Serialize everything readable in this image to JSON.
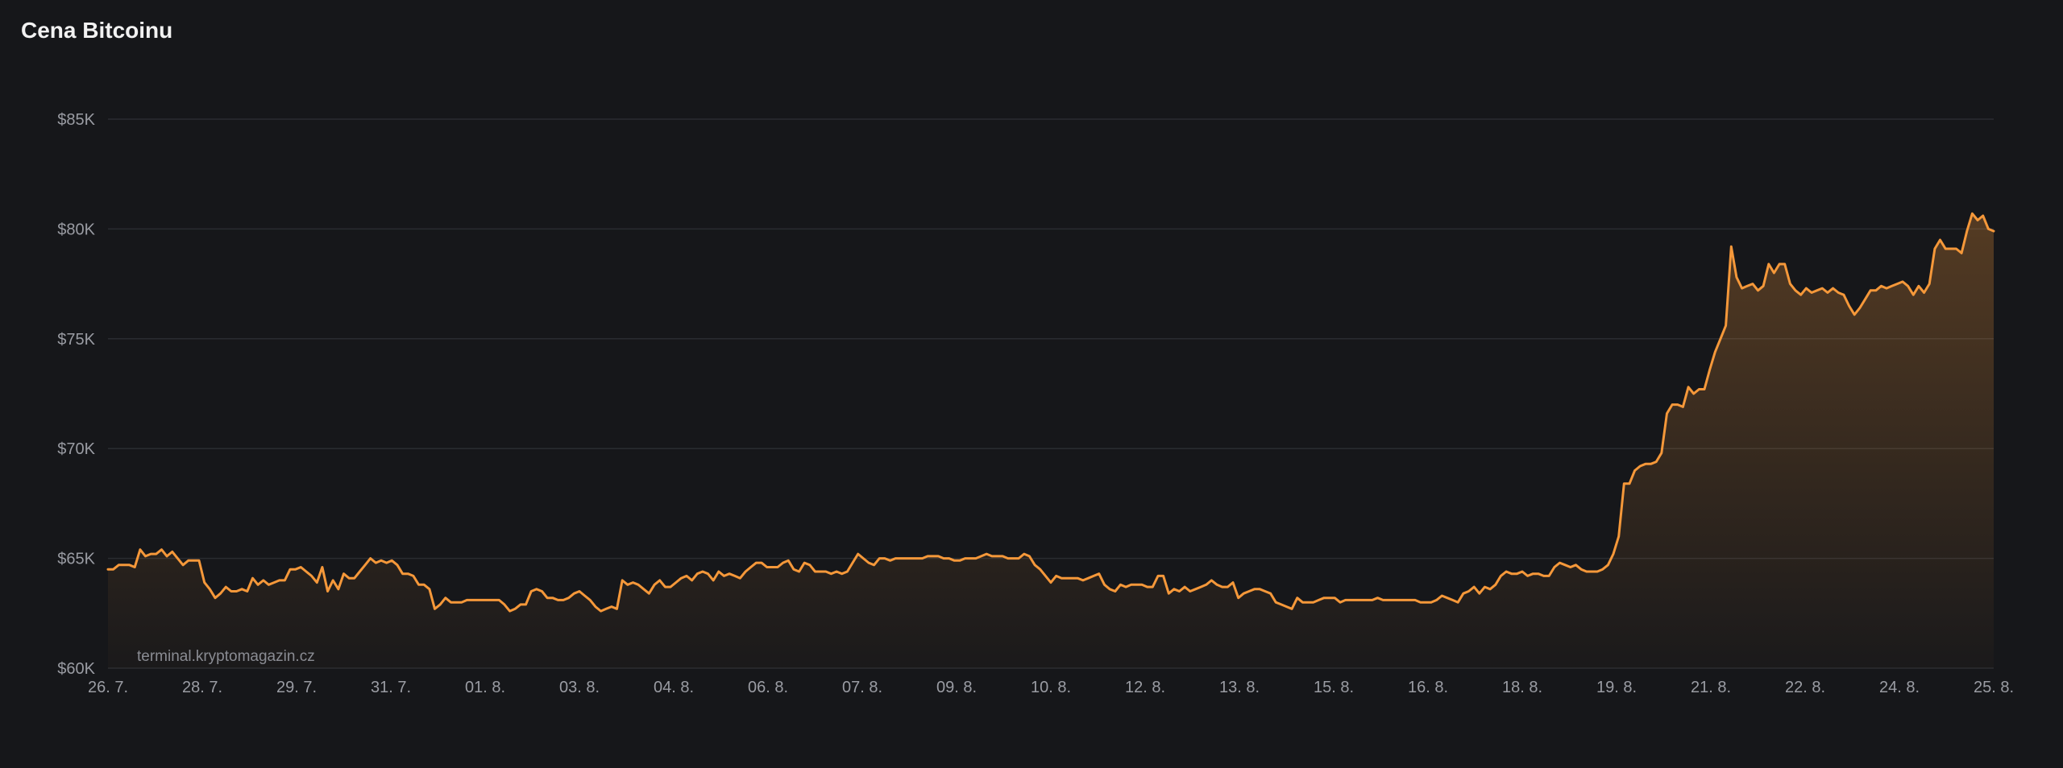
{
  "title": "Cena Bitcoinu",
  "watermark": "terminal.kryptomagazin.cz",
  "colors": {
    "line": "#f5983a",
    "grid": "#2a2c31",
    "background": "#16171a"
  },
  "chart_data": {
    "type": "area",
    "title": "Cena Bitcoinu",
    "xlabel": "",
    "ylabel": "",
    "ylim": [
      60000,
      85000
    ],
    "yticks": [
      60000,
      65000,
      70000,
      75000,
      80000,
      85000
    ],
    "ytick_labels": [
      "$60K",
      "$65K",
      "$70K",
      "$75K",
      "$80K",
      "$85K"
    ],
    "xticks": [
      "26. 7.",
      "28. 7.",
      "29. 7.",
      "31. 7.",
      "01. 8.",
      "03. 8.",
      "04. 8.",
      "06. 8.",
      "07. 8.",
      "09. 8.",
      "10. 8.",
      "12. 8.",
      "13. 8.",
      "15. 8.",
      "16. 8.",
      "18. 8.",
      "19. 8.",
      "21. 8.",
      "22. 8.",
      "24. 8.",
      "25. 8."
    ],
    "grid": true,
    "series": [
      {
        "values": [
          64500,
          64500,
          64700,
          64700,
          64700,
          64600,
          65400,
          65100,
          65200,
          65200,
          65400,
          65100,
          65300,
          65000,
          64700,
          64900,
          64900,
          64900,
          63900,
          63600,
          63200,
          63400,
          63700,
          63500,
          63500,
          63600,
          63500,
          64100,
          63800,
          64000,
          63800,
          63900,
          64000,
          64000,
          64500,
          64500,
          64600,
          64400,
          64200,
          63900,
          64600,
          63500,
          64000,
          63600,
          64300,
          64100,
          64100,
          64400,
          64700,
          65000,
          64800,
          64900,
          64800,
          64900,
          64700,
          64300,
          64300,
          64200,
          63800,
          63800,
          63600,
          62700,
          62900,
          63200,
          63000,
          63000,
          63000,
          63100,
          63100,
          63100,
          63100,
          63100,
          63100,
          63100,
          62900,
          62600,
          62700,
          62900,
          62900,
          63500,
          63600,
          63500,
          63200,
          63200,
          63100,
          63100,
          63200,
          63400,
          63500,
          63300,
          63100,
          62800,
          62600,
          62700,
          62800,
          62700,
          64000,
          63800,
          63900,
          63800,
          63600,
          63400,
          63800,
          64000,
          63700,
          63700,
          63900,
          64100,
          64200,
          64000,
          64300,
          64400,
          64300,
          64000,
          64400,
          64200,
          64300,
          64200,
          64100,
          64400,
          64600,
          64800,
          64800,
          64600,
          64600,
          64600,
          64800,
          64900,
          64500,
          64400,
          64800,
          64700,
          64400,
          64400,
          64400,
          64300,
          64400,
          64300,
          64400,
          64800,
          65200,
          65000,
          64800,
          64700,
          65000,
          65000,
          64900,
          65000,
          65000,
          65000,
          65000,
          65000,
          65000,
          65100,
          65100,
          65100,
          65000,
          65000,
          64900,
          64900,
          65000,
          65000,
          65000,
          65100,
          65200,
          65100,
          65100,
          65100,
          65000,
          65000,
          65000,
          65200,
          65100,
          64700,
          64500,
          64200,
          63900,
          64200,
          64100,
          64100,
          64100,
          64100,
          64000,
          64100,
          64200,
          64300,
          63800,
          63600,
          63500,
          63800,
          63700,
          63800,
          63800,
          63800,
          63700,
          63700,
          64200,
          64200,
          63400,
          63600,
          63500,
          63700,
          63500,
          63600,
          63700,
          63800,
          64000,
          63800,
          63700,
          63700,
          63900,
          63200,
          63400,
          63500,
          63600,
          63600,
          63500,
          63400,
          63000,
          62900,
          62800,
          62700,
          63200,
          63000,
          63000,
          63000,
          63100,
          63200,
          63200,
          63200,
          63000,
          63100,
          63100,
          63100,
          63100,
          63100,
          63100,
          63200,
          63100,
          63100,
          63100,
          63100,
          63100,
          63100,
          63100,
          63000,
          63000,
          63000,
          63100,
          63300,
          63200,
          63100,
          63000,
          63400,
          63500,
          63700,
          63400,
          63700,
          63600,
          63800,
          64200,
          64400,
          64300,
          64300,
          64400,
          64200,
          64300,
          64300,
          64200,
          64200,
          64600,
          64800,
          64700,
          64600,
          64700,
          64500,
          64400,
          64400,
          64400,
          64500,
          64700,
          65200,
          66000,
          68400,
          68400,
          69000,
          69200,
          69300,
          69300,
          69400,
          69800,
          71600,
          72000,
          72000,
          71900,
          72800,
          72500,
          72700,
          72700,
          73600,
          74400,
          75000,
          75600,
          79200,
          77800,
          77300,
          77400,
          77500,
          77200,
          77400,
          78400,
          78000,
          78400,
          78400,
          77500,
          77200,
          77000,
          77300,
          77100,
          77200,
          77300,
          77100,
          77300,
          77100,
          77000,
          76500,
          76100,
          76400,
          76800,
          77200,
          77200,
          77400,
          77300,
          77400,
          77500,
          77600,
          77400,
          77000,
          77400,
          77100,
          77500,
          79100,
          79500,
          79100,
          79100,
          79100,
          78900,
          79900,
          80700,
          80400,
          80600,
          80000,
          79900
        ]
      }
    ]
  }
}
